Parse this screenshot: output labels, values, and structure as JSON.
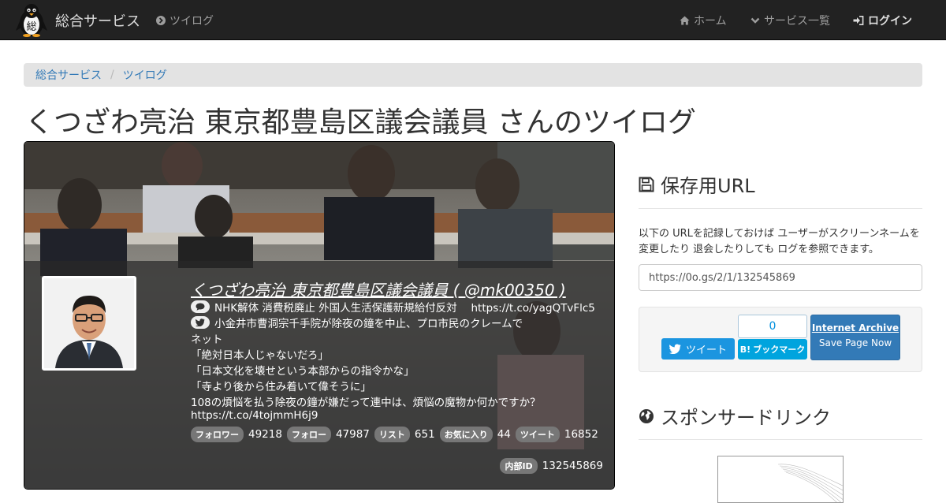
{
  "navbar": {
    "logo_letter": "総",
    "brand": "総合サービス",
    "current_service": "ツイログ",
    "links": {
      "home": "ホーム",
      "services": "サービス一覧",
      "login": "ログイン"
    }
  },
  "breadcrumb": [
    "総合サービス",
    "ツイログ"
  ],
  "page_title": "くつざわ亮治 東京都豊島区議会議員 さんのツイログ",
  "profile": {
    "screen_name": "くつざわ亮治 東京都豊島区議会議員 ( @mk00350 )",
    "bio": "NHK解体 消費税廃止 外国人生活保護新規給付反対　 https://t.co/yagQTvFlc5",
    "latest_tweet_lines": [
      "小金井市曹洞宗千手院が除夜の鐘を中止、プロ市民のクレームで",
      "ネット",
      "「絶対日本人じゃないだろ」",
      "「日本文化を壊せという本部からの指令かな」",
      "「寺より後から住み着いて偉そうに」",
      "108の煩悩を払う除夜の鐘が嫌だって連中は、煩悩の魔物か何かですか？",
      "https://t.co/4tojmmH6j9"
    ],
    "stats": [
      {
        "label": "フォロワー",
        "value": "49218"
      },
      {
        "label": "フォロー",
        "value": "47987"
      },
      {
        "label": "リスト",
        "value": "651"
      },
      {
        "label": "お気に入り",
        "value": "44"
      },
      {
        "label": "ツイート",
        "value": "16852"
      }
    ],
    "internal_id_label": "内部ID",
    "internal_id": "132545869"
  },
  "save_section": {
    "heading": "保存用URL",
    "note": "以下の URLを記録しておけば ユーザーがスクリーンネームを変更したり 退会したりしても ログを参照できます。",
    "url": "https://0o.gs/2/1/132545869"
  },
  "share": {
    "tweet_label": "ツイート",
    "hatena_count": "0",
    "hatena_label": "ブックマーク",
    "hatena_badge": "B!",
    "archive_title": "Internet Archive",
    "archive_sub": "Save Page Now"
  },
  "sponsor_heading": "スポンサードリンク",
  "colors": {
    "navbar": "#222222",
    "link": "#337ab7",
    "twitter": "#1b95e0",
    "hatena": "#00a4de",
    "archive": "#337ab7"
  }
}
